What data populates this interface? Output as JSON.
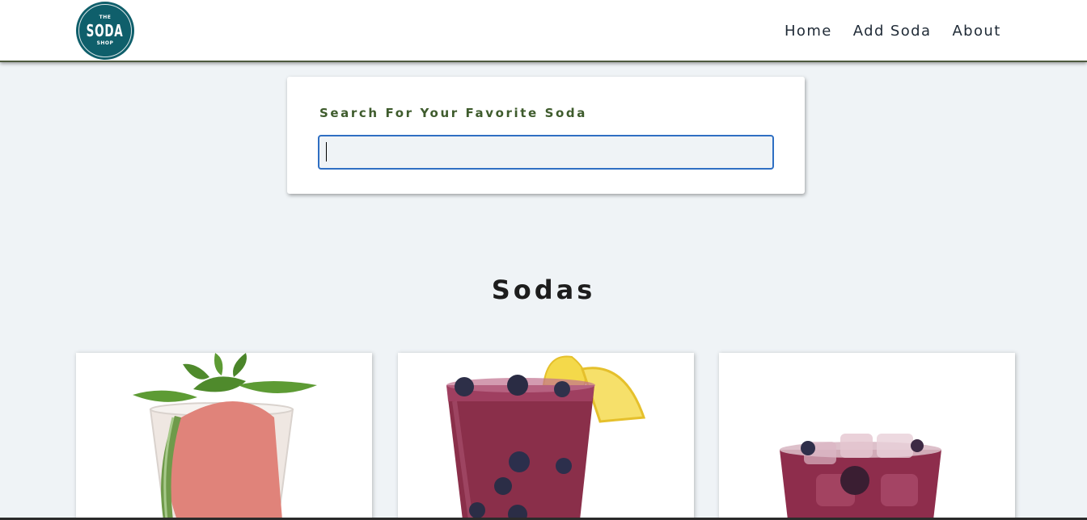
{
  "logo": {
    "top": "THE",
    "main": "SODA",
    "bottom": "SHOP"
  },
  "nav": {
    "home": "Home",
    "add_soda": "Add Soda",
    "about": "About"
  },
  "search": {
    "label": "Search For Your Favorite Soda",
    "value": "",
    "placeholder": ""
  },
  "sodas_heading": "Sodas",
  "sodas": [
    {
      "image": "watermelon-mint-soda-image"
    },
    {
      "image": "blueberry-lemonade-soda-image"
    },
    {
      "image": "mixed-berry-soda-image"
    }
  ],
  "colors": {
    "brand_teal": "#0f5f6b",
    "label_green": "#3e5b2c",
    "focus_blue": "#2f6fc3",
    "page_bg": "#eff3f6"
  }
}
